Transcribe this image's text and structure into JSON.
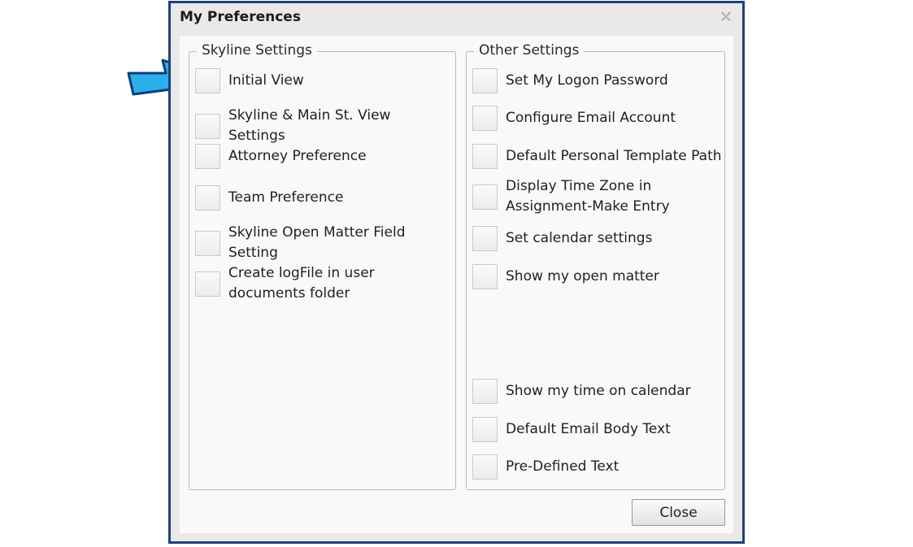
{
  "dialog": {
    "title": "My Preferences"
  },
  "skyline_settings": {
    "legend": "Skyline Settings",
    "items": [
      {
        "label": "Initial View"
      },
      {
        "label": "Skyline & Main St. View Settings"
      },
      {
        "label": "Attorney Preference"
      },
      {
        "label": "Team Preference"
      },
      {
        "label": "Skyline Open Matter Field Setting"
      },
      {
        "label": "Create logFile in user documents folder"
      }
    ]
  },
  "other_settings": {
    "legend": "Other Settings",
    "items": [
      {
        "label": "Set My Logon Password"
      },
      {
        "label": "Configure Email Account"
      },
      {
        "label": "Default Personal Template Path"
      },
      {
        "label": "Display Time Zone in Assignment-Make Entry"
      },
      {
        "label": "Set calendar settings"
      },
      {
        "label": "Show my open matter"
      },
      {
        "label": "Show my time on calendar"
      },
      {
        "label": "Default Email Body Text"
      },
      {
        "label": "Pre-Defined Text"
      }
    ]
  },
  "footer": {
    "close_label": "Close"
  },
  "colors": {
    "window_border": "#1f3f7f",
    "arrow_fill": "#2ab0ea",
    "arrow_stroke": "#0d3d7a"
  }
}
